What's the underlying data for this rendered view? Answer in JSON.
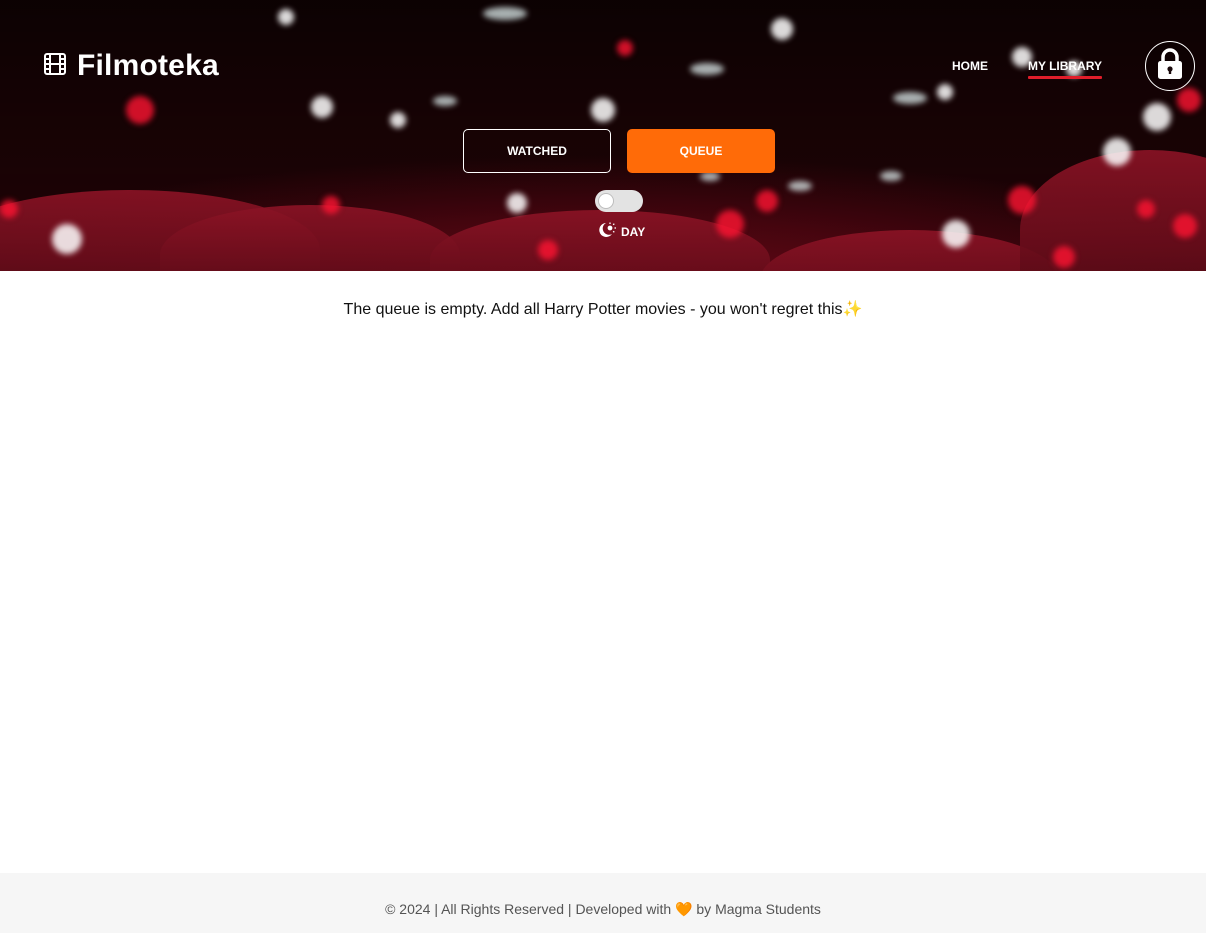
{
  "header": {
    "logo_text": "Filmoteka",
    "logo_icon": "film-icon",
    "nav": [
      {
        "label": "HOME",
        "active": false
      },
      {
        "label": "MY LIBRARY",
        "active": true
      }
    ],
    "lock_icon": "lock-icon"
  },
  "library": {
    "watched_label": "WATCHED",
    "queue_label": "QUEUE",
    "active_tab": "queue"
  },
  "theme": {
    "toggle_on": false,
    "label": "DAY",
    "icon": "moon-sun-icon"
  },
  "main": {
    "empty_message": "The queue is empty. Add all Harry Potter movies - you won't regret this",
    "empty_emoji": "✨"
  },
  "footer": {
    "text_before": "© 2024 | All Rights Reserved | Developed with",
    "heart": "🧡",
    "text_after": "by Magma Students"
  },
  "colors": {
    "accent": "#ff6b08",
    "nav_underline": "#e11d2a"
  }
}
